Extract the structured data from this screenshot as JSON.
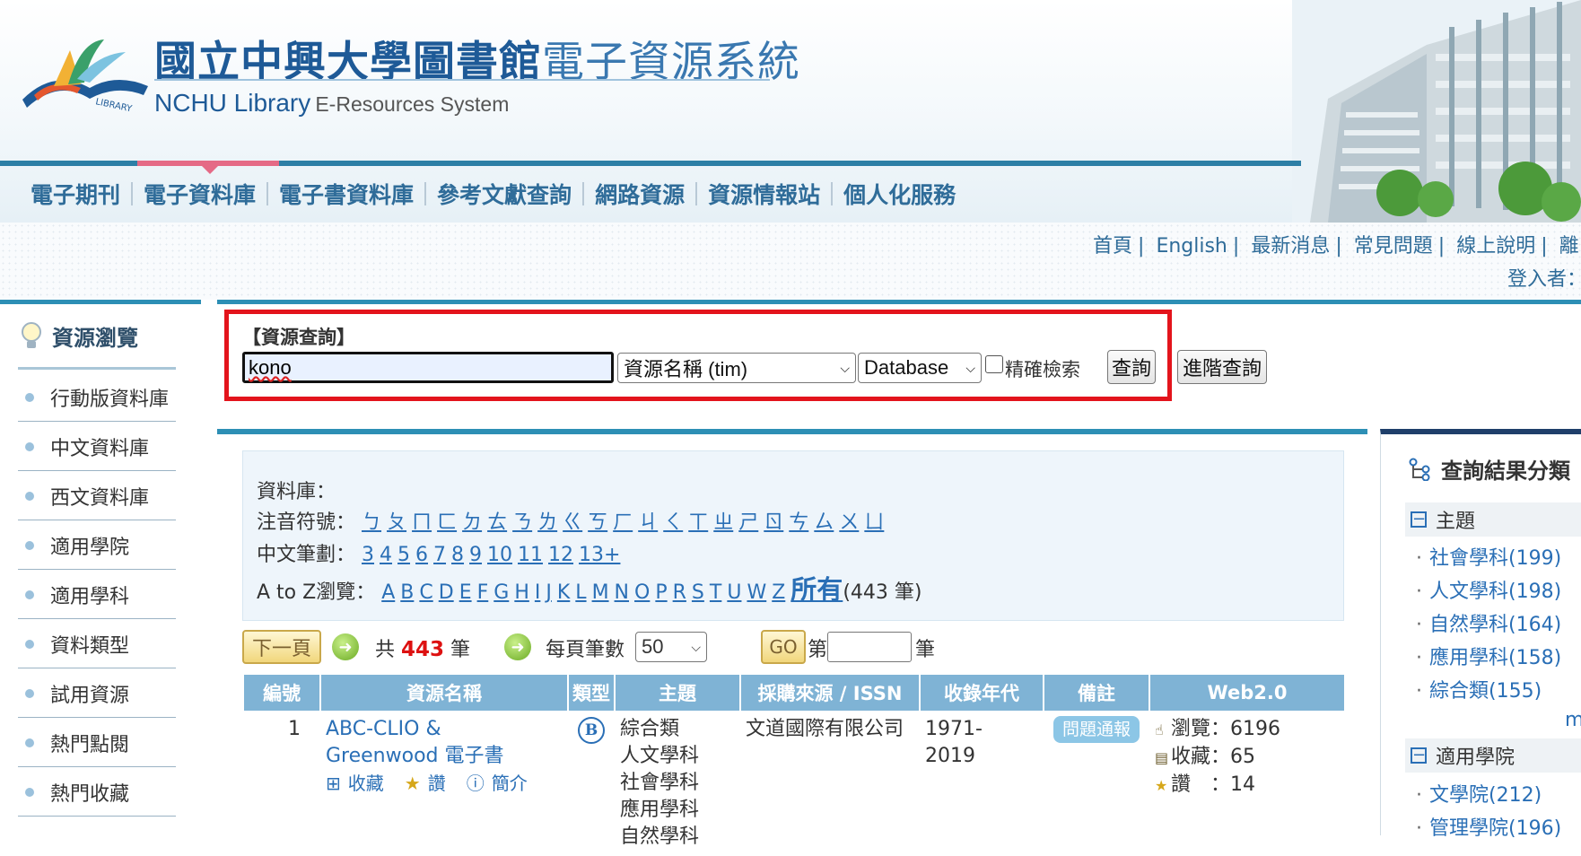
{
  "header": {
    "title_cn_bold": "國立中興大學圖書館",
    "title_cn_light": "電子資源系統",
    "title_en_main": "NCHU Library",
    "title_en_sub": "E-Resources System",
    "logo_text": "LIBRARY"
  },
  "nav": {
    "items": [
      "電子期刊",
      "電子資料庫",
      "電子書資料庫",
      "參考文獻查詢",
      "網路資源",
      "資源情報站",
      "個人化服務"
    ],
    "active": "電子資料庫"
  },
  "utility": {
    "links": [
      "首頁",
      "English",
      "最新消息",
      "常見問題",
      "線上說明",
      "離"
    ],
    "login_label": "登入者："
  },
  "sidebar": {
    "heading": "資源瀏覽",
    "items": [
      "行動版資料庫",
      "中文資料庫",
      "西文資料庫",
      "適用學院",
      "適用學科",
      "資料類型",
      "試用資源",
      "熱門點閱",
      "熱門收藏"
    ]
  },
  "search": {
    "title": "【資源查詢】",
    "keyword": "kono",
    "field_select": "資源名稱 (tim)",
    "type_select": "Database",
    "exact_label": "精確檢索",
    "exact_checked": false,
    "search_button": "查詢",
    "advanced_button": "進階查詢"
  },
  "browse": {
    "db_label": "資料庫：",
    "zhuyin_label": "注音符號：",
    "zhuyin": [
      "ㄅ",
      "ㄆ",
      "ㄇ",
      "ㄈ",
      "ㄉ",
      "ㄊ",
      "ㄋ",
      "ㄌ",
      "ㄍ",
      "ㄎ",
      "ㄏ",
      "ㄐ",
      "ㄑ",
      "ㄒ",
      "ㄓ",
      "ㄕ",
      "ㄖ",
      "ㄘ",
      "ㄙ",
      "ㄨ",
      "ㄩ"
    ],
    "strokes_label": "中文筆劃：",
    "strokes": [
      "3",
      "4",
      "5",
      "6",
      "7",
      "8",
      "9",
      "10",
      "11",
      "12",
      "13+"
    ],
    "az_label": "A to Z瀏覽：",
    "letters": [
      "A",
      "B",
      "C",
      "D",
      "E",
      "F",
      "G",
      "H",
      "I",
      "J",
      "K",
      "L",
      "M",
      "N",
      "O",
      "P",
      "R",
      "S",
      "T",
      "U",
      "W",
      "Z"
    ],
    "all_label": "所有",
    "all_count": "(443 筆)"
  },
  "pager": {
    "next_button": "下一頁",
    "total_prefix": "共",
    "total": "443",
    "total_suffix": "筆",
    "per_page_label": "每頁筆數",
    "per_page_value": "50",
    "go_button": "GO",
    "page_prefix": "第",
    "page_suffix": "筆"
  },
  "table": {
    "headers": [
      "編號",
      "資源名稱",
      "類型",
      "主題",
      "採購來源 / ISSN",
      "收錄年代",
      "備註",
      "Web2.0"
    ],
    "rows": [
      {
        "no": "1",
        "title_line1": "ABC-CLIO &",
        "title_line2": "Greenwood 電子書",
        "action_collect": "收藏",
        "action_like": "讚",
        "action_intro": "簡介",
        "type_badge": "B",
        "subjects": [
          "綜合類",
          "人文學科",
          "社會學科",
          "應用學科",
          "自然學科"
        ],
        "source": "文道國際有限公司",
        "years_line1": "1971-",
        "years_line2": "2019",
        "note_button": "問題通報",
        "web_views": "瀏覽：6196",
        "web_collects": "收藏：65",
        "web_likes": "讚　：14"
      }
    ]
  },
  "facets": {
    "heading": "查詢結果分類",
    "section1": "主題",
    "section1_items": [
      "社會學科(199)",
      "人文學科(198)",
      "自然學科(164)",
      "應用學科(158)",
      "綜合類(155)"
    ],
    "more": "m",
    "section2": "適用學院",
    "section2_items": [
      "文學院(212)",
      "管理學院(196)"
    ]
  },
  "colors": {
    "accent": "#2d8fb5",
    "highlight_frame": "#e3141c",
    "link": "#2a6fb6",
    "table_header": "#7fb3d5"
  }
}
